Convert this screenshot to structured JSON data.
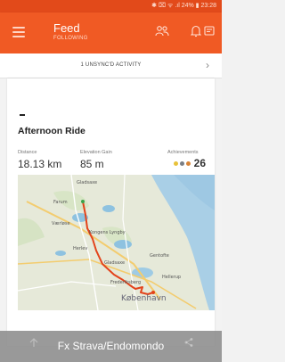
{
  "status_bar": {
    "text": "✱ ⌧ ᯤ .ıl 24% ▮ 23:28"
  },
  "app_bar": {
    "title": "Feed",
    "subtitle": "FOLLOWING",
    "icons": [
      "menu-icon",
      "people-icon",
      "bell-icon",
      "message-icon"
    ]
  },
  "unsynced": {
    "label": "1 UNSYNC'D ACTIVITY",
    "chevron": "›"
  },
  "activity": {
    "title": "Afternoon Ride",
    "stats": [
      {
        "label": "Distance",
        "value": "18.13 km"
      },
      {
        "label": "Elevation Gain",
        "value": "85 m"
      }
    ],
    "achievements": {
      "label": "Achievements",
      "count": "26",
      "medal_colors": [
        "#e8c23a",
        "#7a7f86",
        "#d88437"
      ]
    },
    "map_labels": {
      "label_1": "Gladsaxe",
      "label_2": "Farum",
      "label_3": "Værløse",
      "label_4": "Kongens Lyngby",
      "label_5": "Gentofte",
      "label_6": "Herlev",
      "label_7": "Gladsaxe",
      "label_8": "Hellerup",
      "label_9": "Frederiksberg",
      "label_10": "København"
    }
  },
  "caption": "Fx Strava/Endomondo"
}
